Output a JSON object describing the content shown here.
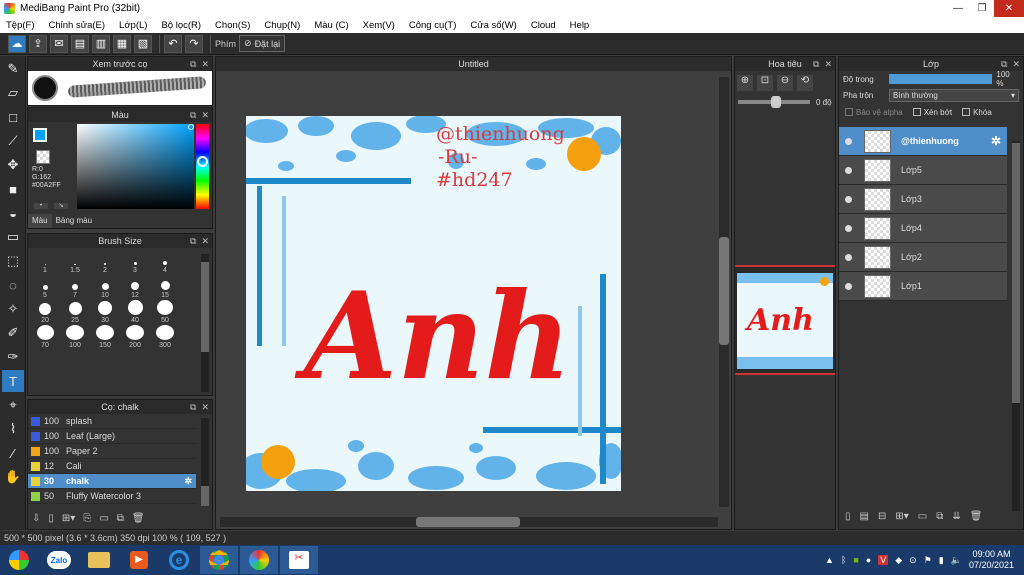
{
  "window": {
    "title": "MediBang Paint Pro (32bit)"
  },
  "menu": [
    "Tệp(F)",
    "Chỉnh sửa(E)",
    "Lớp(L)",
    "Bộ lọc(R)",
    "Chọn(S)",
    "Chụp(N)",
    "Màu (C)",
    "Xem(V)",
    "Công cụ(T)",
    "Cửa sổ(W)",
    "Cloud",
    "Help"
  ],
  "toolbar": {
    "key_label": "Phím",
    "reset_label": "Đặt lại"
  },
  "brush_preview": {
    "title": "Xem trước cọ"
  },
  "color_panel": {
    "title": "Màu",
    "readout": [
      "R:0",
      "G:162",
      "#00A2FF"
    ],
    "tabs": [
      "Màu",
      "Bảng màu"
    ],
    "fg_color": "#00A2FF"
  },
  "brush_size": {
    "title": "Brush Size",
    "sizes": [
      "1",
      "1.5",
      "2",
      "3",
      "4",
      "5",
      "7",
      "10",
      "12",
      "15",
      "20",
      "25",
      "30",
      "40",
      "50",
      "70",
      "100",
      "150",
      "200",
      "300"
    ]
  },
  "brush_list": {
    "title": "Cọ: chalk",
    "items": [
      {
        "size": "100",
        "name": "splash",
        "color": "#3a5bd9",
        "selected": false
      },
      {
        "size": "100",
        "name": "Leaf (Large)",
        "color": "#3a5bd9",
        "selected": false
      },
      {
        "size": "100",
        "name": "Paper 2",
        "color": "#f2a51a",
        "selected": false
      },
      {
        "size": "12",
        "name": "Cali",
        "color": "#e8d23a",
        "selected": false
      },
      {
        "size": "30",
        "name": "chalk",
        "color": "#e8d23a",
        "selected": true
      },
      {
        "size": "50",
        "name": "Fluffy Watercolor 3",
        "color": "#8fd24a",
        "selected": false
      }
    ]
  },
  "canvas": {
    "tab": "Untitled",
    "watermark": [
      "@thienhuong",
      "-Ru-",
      "#hd247"
    ],
    "title_text": "Anh"
  },
  "navigator": {
    "title": "Hoa tiêu",
    "angle": "0 độ"
  },
  "layers": {
    "title": "Lớp",
    "opacity_label": "Độ trong",
    "opacity_value": "100 %",
    "blend_label": "Pha trộn",
    "blend_value": "Bình thường",
    "protect_alpha": "Bảo vệ alpha",
    "clip": "Xén bớt",
    "lock": "Khóa",
    "items": [
      {
        "name": "@thienhuong",
        "selected": true
      },
      {
        "name": "Lớp5"
      },
      {
        "name": "Lớp3"
      },
      {
        "name": "Lớp4"
      },
      {
        "name": "Lớp2"
      },
      {
        "name": "Lớp1"
      }
    ]
  },
  "status": {
    "text": "500 * 500 pixel  (3.6 * 3.6cm)  350 dpi  100 %  ( 109, 527 )"
  },
  "taskbar": {
    "zalo": "Zalo",
    "time": "09:00 AM",
    "date": "07/20/2021"
  }
}
